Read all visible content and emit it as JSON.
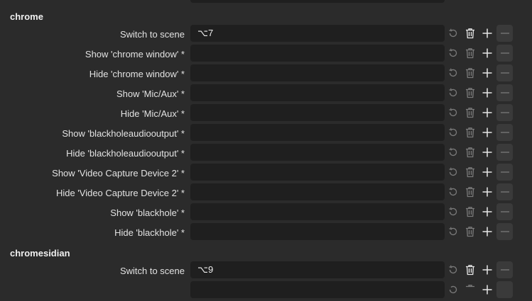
{
  "sections": [
    {
      "title": "chrome",
      "rows": [
        {
          "label": "Switch to scene",
          "value": "⌥7"
        },
        {
          "label": "Show 'chrome window' *",
          "value": ""
        },
        {
          "label": "Hide 'chrome window' *",
          "value": ""
        },
        {
          "label": "Show 'Mic/Aux' *",
          "value": ""
        },
        {
          "label": "Hide 'Mic/Aux' *",
          "value": ""
        },
        {
          "label": "Show 'blackholeaudiooutput' *",
          "value": ""
        },
        {
          "label": "Hide 'blackholeaudiooutput' *",
          "value": ""
        },
        {
          "label": "Show 'Video Capture Device 2' *",
          "value": ""
        },
        {
          "label": "Hide 'Video Capture Device 2' *",
          "value": ""
        },
        {
          "label": "Show 'blackhole' *",
          "value": ""
        },
        {
          "label": "Hide 'blackhole' *",
          "value": ""
        }
      ]
    },
    {
      "title": "chromesidian",
      "rows": [
        {
          "label": "Switch to scene",
          "value": "⌥9"
        }
      ]
    }
  ],
  "icons": {
    "reset": "reset-icon",
    "delete": "trash-icon",
    "add": "plus-icon",
    "remove": "minus-icon"
  },
  "colors": {
    "background": "#2b2b2b",
    "field": "#1f1f1f",
    "icon_active": "#e8e8e8",
    "icon_disabled": "#7a7a7a"
  }
}
